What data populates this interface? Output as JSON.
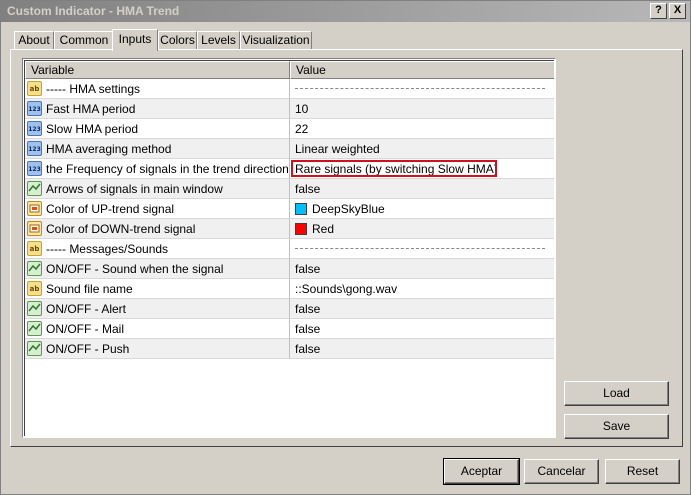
{
  "window": {
    "title": "Custom Indicator - HMA Trend",
    "help_label": "?",
    "close_label": "X"
  },
  "tabs": [
    {
      "label": "About"
    },
    {
      "label": "Common"
    },
    {
      "label": "Inputs"
    },
    {
      "label": "Colors"
    },
    {
      "label": "Levels"
    },
    {
      "label": "Visualization"
    }
  ],
  "active_tab": "Inputs",
  "grid": {
    "col_variable": "Variable",
    "col_value": "Value",
    "rows": [
      {
        "icon": "string-icon",
        "variable": "----- HMA settings",
        "value": "",
        "dashed": true
      },
      {
        "icon": "number-icon",
        "variable": "Fast HMA period",
        "value": "10"
      },
      {
        "icon": "number-icon",
        "variable": "Slow HMA period",
        "value": "22"
      },
      {
        "icon": "number-icon",
        "variable": "HMA averaging method",
        "value": "Linear weighted"
      },
      {
        "icon": "number-icon",
        "variable": "the Frequency of signals in the trend direction",
        "value": "Rare signals (by switching Slow HMA)",
        "highlighted": true
      },
      {
        "icon": "bool-icon",
        "variable": "Arrows of signals in main window",
        "value": "false"
      },
      {
        "icon": "color-icon",
        "variable": "Color of UP-trend signal",
        "value": "DeepSkyBlue",
        "swatch": "#00bfff"
      },
      {
        "icon": "color-icon",
        "variable": "Color of DOWN-trend signal",
        "value": "Red",
        "swatch": "#ff0000"
      },
      {
        "icon": "string-icon",
        "variable": "----- Messages/Sounds",
        "value": "",
        "dashed": true
      },
      {
        "icon": "bool-icon",
        "variable": "ON/OFF - Sound when the signal",
        "value": "false"
      },
      {
        "icon": "string-icon",
        "variable": "Sound file name",
        "value": "::Sounds\\gong.wav"
      },
      {
        "icon": "bool-icon",
        "variable": "ON/OFF - Alert",
        "value": "false"
      },
      {
        "icon": "bool-icon",
        "variable": "ON/OFF - Mail",
        "value": "false"
      },
      {
        "icon": "bool-icon",
        "variable": "ON/OFF - Push",
        "value": "false"
      }
    ]
  },
  "side_buttons": {
    "load": "Load",
    "save": "Save"
  },
  "footer_buttons": {
    "ok": "Aceptar",
    "cancel": "Cancelar",
    "reset": "Reset"
  },
  "colors": {
    "highlight_border": "#d0101c",
    "row_shade": "#f0f0f0"
  }
}
